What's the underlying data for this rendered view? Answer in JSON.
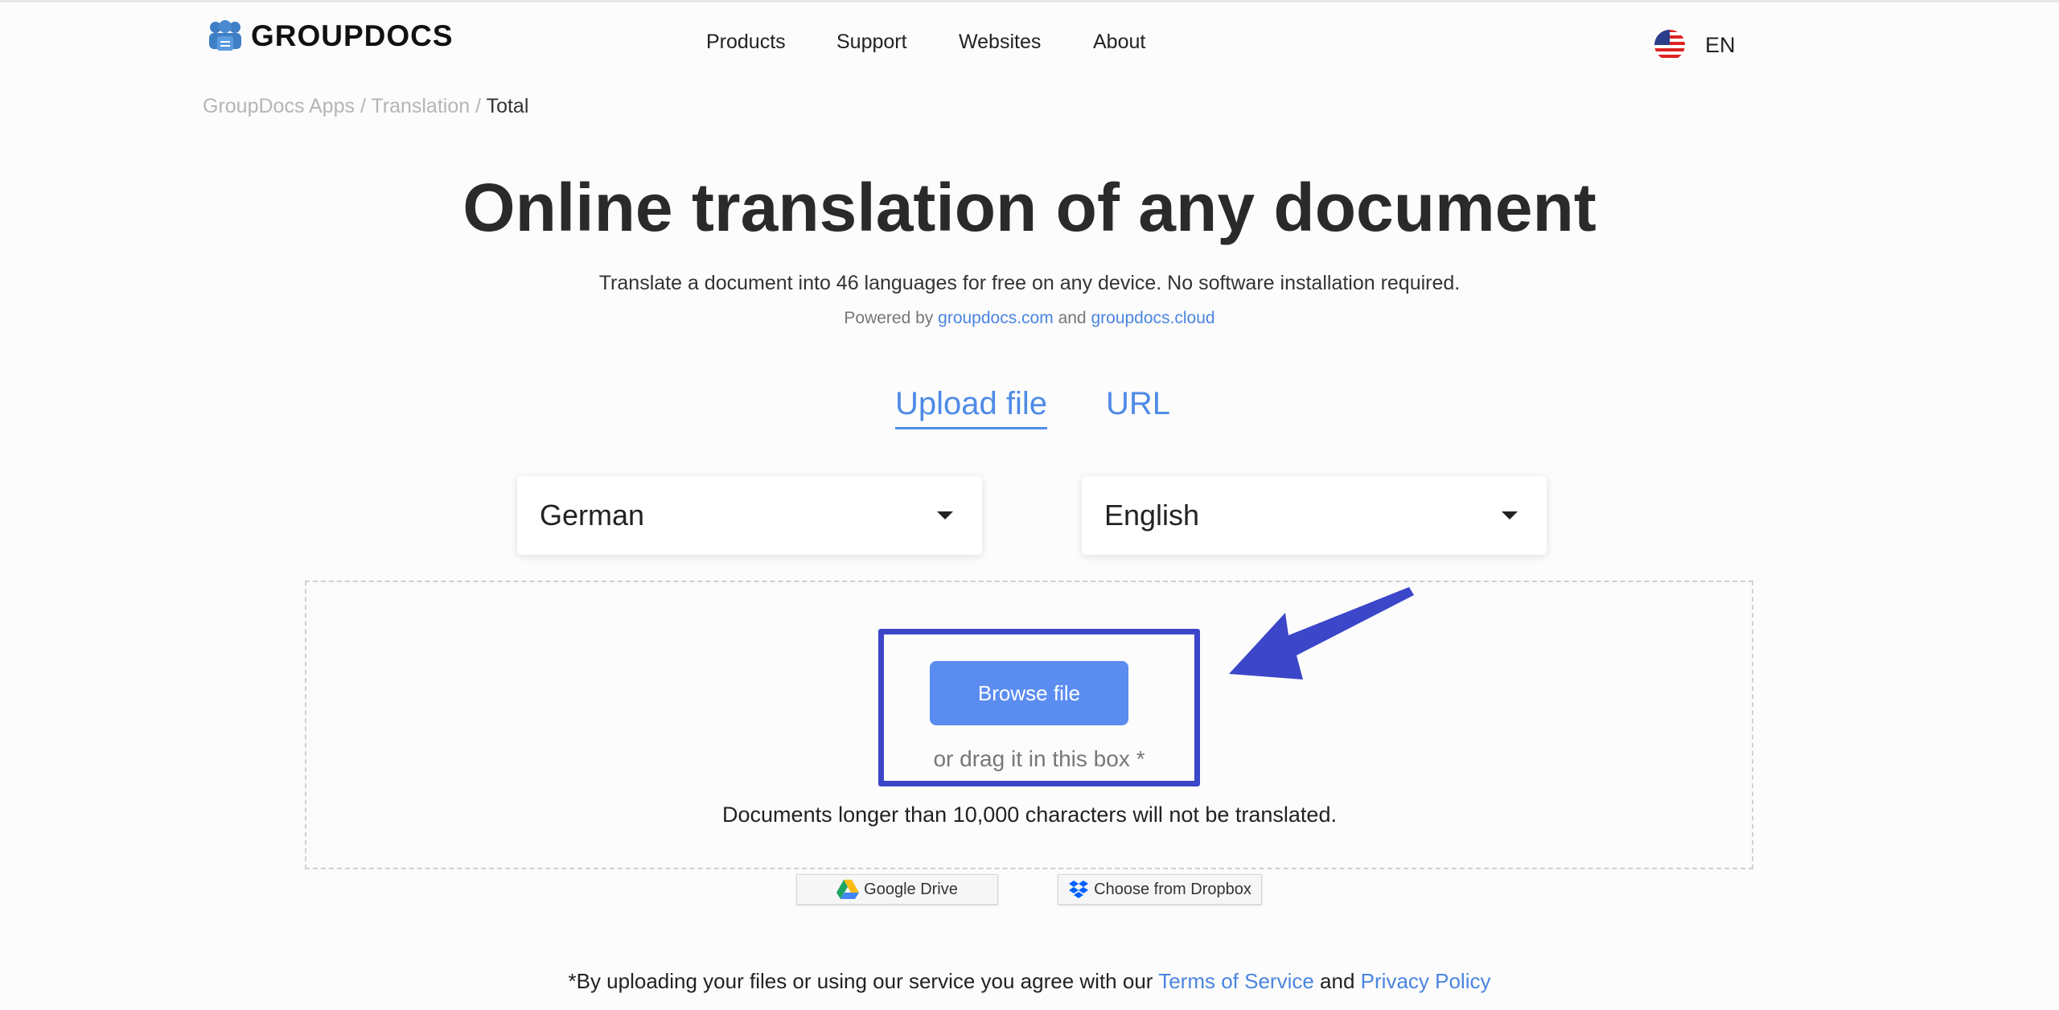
{
  "header": {
    "logo_text": "GROUPDOCS",
    "nav": [
      "Products",
      "Support",
      "Websites",
      "About"
    ],
    "language": "EN"
  },
  "breadcrumb": {
    "items": [
      "GroupDocs Apps",
      "Translation"
    ],
    "current": "Total",
    "separator": "/"
  },
  "hero": {
    "title": "Online translation of any document",
    "subtitle": "Translate a document into 46 languages for free on any device. No software installation required.",
    "powered_prefix": "Powered by",
    "powered_link1": "groupdocs.com",
    "powered_and": "and",
    "powered_link2": "groupdocs.cloud"
  },
  "tabs": {
    "upload": "Upload file",
    "url": "URL",
    "active": "upload"
  },
  "languages": {
    "source": "German",
    "target": "English"
  },
  "dropzone": {
    "browse_label": "Browse file",
    "drag_text": "or drag it in this box *",
    "limit_text": "Documents longer than 10,000 characters will not be translated."
  },
  "cloud": {
    "google_drive": "Google Drive",
    "dropbox": "Choose from Dropbox"
  },
  "footer": {
    "prefix": "*By uploading your files or using our service you agree with our",
    "terms": "Terms of Service",
    "and": "and",
    "privacy": "Privacy Policy"
  },
  "colors": {
    "accent": "#4f8be6",
    "highlight": "#3b46c8",
    "button": "#5b8cf0"
  }
}
